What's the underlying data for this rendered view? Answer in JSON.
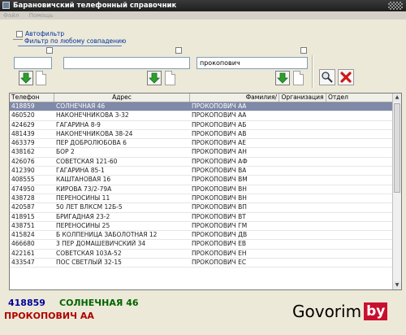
{
  "window": {
    "title": "Барановичский телефонный справочник"
  },
  "menu": [
    "Файл",
    "Помощь"
  ],
  "filters": {
    "autofilter_label": "Автофильтр",
    "any_match_label": "Фильтр по любому совпадению",
    "phone_value": "",
    "address_value": "",
    "surname_value": "прокопович"
  },
  "table": {
    "columns": [
      "Телефон",
      "Адрес",
      "Фамилия/",
      "Организация",
      "Отдел"
    ],
    "rows": [
      [
        "418859",
        "СОЛНЕЧНАЯ 46",
        "ПРОКОПОВИЧ АА"
      ],
      [
        "460520",
        "НАКОНЕЧНИКОВА 3-32",
        "ПРОКОПОВИЧ АА"
      ],
      [
        "424629",
        "ГАГАРИНА 8-9",
        "ПРОКОПОВИЧ АБ"
      ],
      [
        "481439",
        "НАКОНЕЧНИКОВА 38-24",
        "ПРОКОПОВИЧ АВ"
      ],
      [
        "463379",
        "ПЕР ДОБРОЛЮБОВА 6",
        "ПРОКОПОВИЧ АЕ"
      ],
      [
        "438162",
        "БОР 2",
        "ПРОКОПОВИЧ АН"
      ],
      [
        "426076",
        "СОВЕТСКАЯ 121-60",
        "ПРОКОПОВИЧ АФ"
      ],
      [
        "412390",
        "ГАГАРИНА 85-1",
        "ПРОКОПОВИЧ ВА"
      ],
      [
        "408555",
        "КАШТАНОВАЯ 16",
        "ПРОКОПОВИЧ ВМ"
      ],
      [
        "474950",
        "КИРОВА 73/2-79А",
        "ПРОКОПОВИЧ ВН"
      ],
      [
        "438728",
        "ПЕРЕНОСИНЫ 11",
        "ПРОКОПОВИЧ ВН"
      ],
      [
        "420587",
        "50 ЛЕТ ВЛКСМ 12Б-5",
        "ПРОКОПОВИЧ ВП"
      ],
      [
        "418915",
        "БРИГАДНАЯ 23-2",
        "ПРОКОПОВИЧ ВТ"
      ],
      [
        "438751",
        "ПЕРЕНОСИНЫ 25",
        "ПРОКОПОВИЧ ГМ"
      ],
      [
        "415824",
        "Б КОЛПЕНИЦА ЗАБОЛОТНАЯ 12",
        "ПРОКОПОВИЧ ДВ"
      ],
      [
        "466680",
        "3 ПЕР ДОМАШЕВИЧСКИЙ 34",
        "ПРОКОПОВИЧ ЕВ"
      ],
      [
        "422161",
        "СОВЕТСКАЯ 103А-52",
        "ПРОКОПОВИЧ ЕН"
      ],
      [
        "433547",
        "ПОС СВЕТЛЫЙ 32-15",
        "ПРОКОПОВИЧ ЕС"
      ]
    ]
  },
  "footer": {
    "phone": "418859",
    "address": "СОЛНЕЧНАЯ 46",
    "name": "ПРОКОПОВИЧ АА"
  },
  "logo": {
    "text": "Govorim",
    "badge": "by"
  },
  "colors": {
    "selection": "#7f89a8",
    "accent_red": "#c8102e",
    "phone_blue": "#0000a0",
    "address_green": "#006400"
  }
}
